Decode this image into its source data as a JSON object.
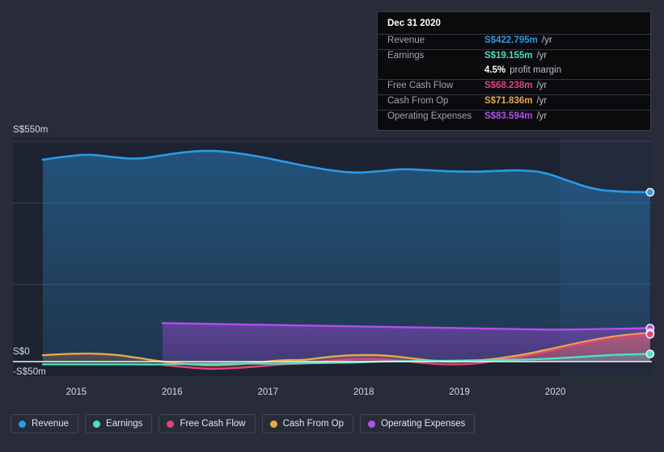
{
  "currency_prefix": "S$",
  "colors": {
    "background": "#282c39",
    "plot_background": "#1d2330",
    "forecast_background": "#222a3c",
    "gridline": "#3b4150",
    "axis_line": "#f2f4f7",
    "revenue": "#2b9ae8",
    "earnings": "#4fe0c0",
    "free_cash_flow": "#e0447c",
    "cash_from_op": "#e8a84d",
    "operating_expenses": "#b24df0",
    "tooltip_bg": "#0b0b0d",
    "tooltip_border": "#3a3f4d"
  },
  "tooltip": {
    "date": "Dec 31 2020",
    "rows": [
      {
        "key": "Revenue",
        "value": "S$422.795m",
        "unit": "/yr",
        "color": "#2b9ae8"
      },
      {
        "key": "Earnings",
        "value": "S$19.155m",
        "unit": "/yr",
        "color": "#4fe0c0"
      },
      {
        "key": "",
        "value": "4.5%",
        "unit": "profit margin",
        "color": "#ffffff"
      },
      {
        "key": "Free Cash Flow",
        "value": "S$68.238m",
        "unit": "/yr",
        "color": "#e0447c"
      },
      {
        "key": "Cash From Op",
        "value": "S$71.836m",
        "unit": "/yr",
        "color": "#e8a84d"
      },
      {
        "key": "Operating Expenses",
        "value": "S$83.594m",
        "unit": "/yr",
        "color": "#b24df0"
      }
    ]
  },
  "legend": {
    "items": [
      {
        "label": "Revenue",
        "color": "#2b9ae8"
      },
      {
        "label": "Earnings",
        "color": "#4fe0c0"
      },
      {
        "label": "Free Cash Flow",
        "color": "#e0447c"
      },
      {
        "label": "Cash From Op",
        "color": "#e8a84d"
      },
      {
        "label": "Operating Expenses",
        "color": "#b24df0"
      }
    ]
  },
  "axis": {
    "y_labels": [
      {
        "text": "S$550m",
        "value": 550
      },
      {
        "text": "S$0",
        "value": 0
      },
      {
        "text": "-S$50m",
        "value": -50
      }
    ],
    "x_labels": [
      "2015",
      "2016",
      "2017",
      "2018",
      "2019",
      "2020"
    ]
  },
  "chart_data": {
    "type": "area",
    "title": "",
    "subtitle": "",
    "xlabel": "",
    "ylabel": "",
    "ylim": [
      -50,
      550
    ],
    "xlim": [
      "2014.6",
      "2021.0"
    ],
    "ytick_labels": [
      "S$550m",
      "S$0",
      "-S$50m"
    ],
    "ytick_values": [
      550,
      0,
      -50
    ],
    "xtick_labels": [
      "2015",
      "2016",
      "2017",
      "2018",
      "2019",
      "2020"
    ],
    "xtick_values": [
      2015,
      2016,
      2017,
      2018,
      2019,
      2020
    ],
    "grid": true,
    "gridline_values": [
      550,
      396,
      193
    ],
    "legend_position": "bottom",
    "units": "S$ millions per year",
    "highlight_band": {
      "from": 2019.95,
      "to": 2021.0,
      "label": "forecast"
    },
    "hover_point": {
      "x": "Dec 31 2020",
      "x_value": 2020.99
    },
    "series": [
      {
        "name": "Revenue",
        "color": "#2b9ae8",
        "x": [
          2014.65,
          2014.9,
          2015.15,
          2015.4,
          2015.65,
          2015.9,
          2016.15,
          2016.4,
          2016.65,
          2016.9,
          2017.15,
          2017.4,
          2017.65,
          2017.9,
          2018.15,
          2018.4,
          2018.65,
          2018.9,
          2019.15,
          2019.4,
          2019.65,
          2019.9,
          2020.15,
          2020.4,
          2020.65,
          2020.99
        ],
        "values": [
          504,
          512,
          516,
          510,
          507,
          515,
          523,
          526,
          521,
          512,
          500,
          488,
          478,
          472,
          475,
          480,
          478,
          475,
          474,
          476,
          477,
          470,
          450,
          432,
          425,
          422.795
        ]
      },
      {
        "name": "Earnings",
        "color": "#4fe0c0",
        "x": [
          2014.65,
          2014.9,
          2015.15,
          2015.4,
          2015.65,
          2015.9,
          2016.15,
          2016.4,
          2016.65,
          2016.9,
          2017.15,
          2017.4,
          2017.65,
          2017.9,
          2018.15,
          2018.4,
          2018.65,
          2018.9,
          2019.15,
          2019.4,
          2019.65,
          2019.9,
          2020.15,
          2020.4,
          2020.65,
          2020.99
        ],
        "values": [
          -7,
          -7,
          -7,
          -7,
          -7,
          -7,
          -6,
          -6,
          -5,
          -5,
          -5,
          -4,
          -3,
          -2,
          0,
          1,
          2,
          2,
          3,
          4,
          5,
          7,
          10,
          14,
          17,
          19.155
        ]
      },
      {
        "name": "Free Cash Flow",
        "color": "#e0447c",
        "x": [
          2015.9,
          2016.15,
          2016.4,
          2016.65,
          2016.9,
          2017.15,
          2017.4,
          2017.65,
          2017.9,
          2018.15,
          2018.4,
          2018.65,
          2018.9,
          2019.15,
          2019.4,
          2019.65,
          2019.9,
          2020.15,
          2020.4,
          2020.65,
          2020.99
        ],
        "values": [
          -8,
          -14,
          -18,
          -16,
          -12,
          -7,
          -4,
          2,
          6,
          6,
          2,
          -4,
          -7,
          -5,
          3,
          12,
          24,
          38,
          50,
          60,
          68.238
        ]
      },
      {
        "name": "Cash From Op",
        "color": "#e8a84d",
        "x": [
          2014.65,
          2014.9,
          2015.15,
          2015.4,
          2015.65,
          2015.9,
          2016.15,
          2016.4,
          2016.65,
          2016.9,
          2017.15,
          2017.4,
          2017.65,
          2017.9,
          2018.15,
          2018.4,
          2018.65,
          2018.9,
          2019.15,
          2019.4,
          2019.65,
          2019.9,
          2020.15,
          2020.4,
          2020.65,
          2020.99
        ],
        "values": [
          16,
          19,
          20,
          17,
          9,
          0,
          -6,
          -9,
          -7,
          -2,
          3,
          5,
          12,
          16,
          16,
          11,
          4,
          0,
          2,
          8,
          17,
          29,
          42,
          54,
          64,
          71.836
        ]
      },
      {
        "name": "Operating Expenses",
        "color": "#b24df0",
        "x": [
          2015.9,
          2016.15,
          2016.4,
          2016.65,
          2016.9,
          2017.15,
          2017.4,
          2017.65,
          2017.9,
          2018.15,
          2018.4,
          2018.65,
          2018.9,
          2019.15,
          2019.4,
          2019.65,
          2019.9,
          2020.15,
          2020.4,
          2020.65,
          2020.99
        ],
        "values": [
          96,
          95,
          94,
          93,
          92,
          91,
          90,
          89,
          88,
          87,
          86,
          85,
          84,
          83,
          82,
          81,
          80,
          80,
          81,
          82,
          83.594
        ]
      }
    ]
  }
}
